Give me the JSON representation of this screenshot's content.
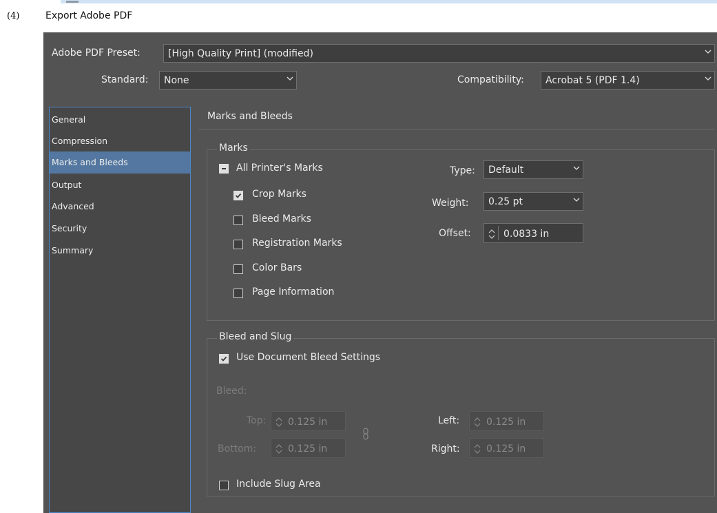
{
  "caption": {
    "number": "(4)",
    "title": "Export Adobe PDF"
  },
  "preset": {
    "label": "Adobe PDF Preset:",
    "value": "[High Quality Print] (modified)"
  },
  "standard": {
    "label": "Standard:",
    "value": "None"
  },
  "compatibility": {
    "label": "Compatibility:",
    "value": "Acrobat 5 (PDF 1.4)"
  },
  "sidebar": {
    "items": [
      {
        "label": "General"
      },
      {
        "label": "Compression"
      },
      {
        "label": "Marks and Bleeds"
      },
      {
        "label": "Output"
      },
      {
        "label": "Advanced"
      },
      {
        "label": "Security"
      },
      {
        "label": "Summary"
      }
    ]
  },
  "section_title": "Marks and Bleeds",
  "marks": {
    "group_title": "Marks",
    "all_printers_marks": {
      "label": "All Printer's Marks",
      "state": "mixed"
    },
    "checkboxes": [
      {
        "label": "Crop Marks",
        "checked": true
      },
      {
        "label": "Bleed Marks",
        "checked": false
      },
      {
        "label": "Registration Marks",
        "checked": false
      },
      {
        "label": "Color Bars",
        "checked": false
      },
      {
        "label": "Page Information",
        "checked": false
      }
    ],
    "type": {
      "label": "Type:",
      "value": "Default"
    },
    "weight": {
      "label": "Weight:",
      "value": "0.25 pt"
    },
    "offset": {
      "label": "Offset:",
      "value": "0.0833 in"
    }
  },
  "bleed_slug": {
    "group_title": "Bleed and Slug",
    "use_doc_bleed": {
      "label": "Use Document Bleed Settings",
      "checked": true
    },
    "bleed_label": "Bleed:",
    "top": {
      "label": "Top:",
      "value": "0.125 in"
    },
    "bottom": {
      "label": "Bottom:",
      "value": "0.125 in"
    },
    "left": {
      "label": "Left:",
      "value": "0.125 in"
    },
    "right": {
      "label": "Right:",
      "value": "0.125 in"
    },
    "include_slug": {
      "label": "Include Slug Area",
      "checked": false
    }
  },
  "colors": {
    "dialog_bg": "#535353",
    "selected_item": "#5377a0",
    "focus_border": "#4a88c9"
  }
}
